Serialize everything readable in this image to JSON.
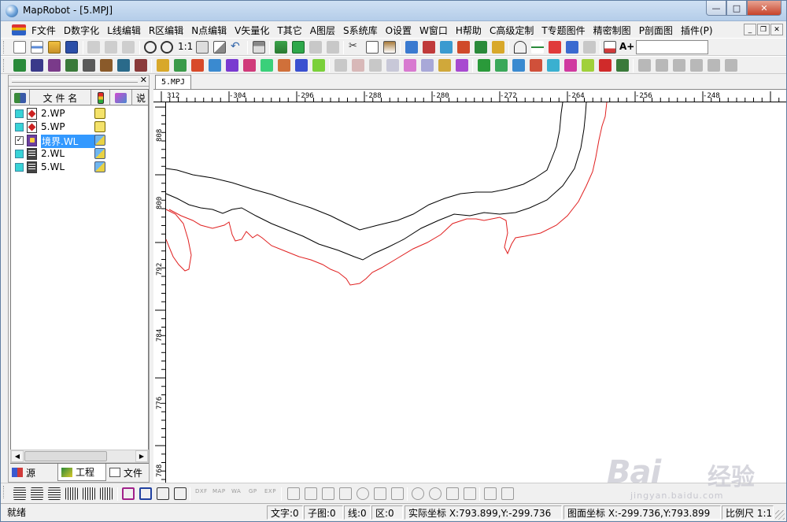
{
  "window": {
    "title": "MapRobot - [5.MPJ]",
    "caption": {
      "minimize": "—",
      "maximize": "□",
      "close": "✕"
    }
  },
  "menu": {
    "items": [
      "F文件",
      "D数字化",
      "L线编辑",
      "R区编辑",
      "N点编辑",
      "V矢量化",
      "T其它",
      "A图层",
      "S系统库",
      "O设置",
      "W窗口",
      "H帮助",
      "C高级定制",
      "T专题图件",
      "精密制图",
      "P剖面图",
      "插件(P)"
    ],
    "mdi": {
      "minimize": "_",
      "restore": "❐",
      "close": "✕"
    }
  },
  "toolbar": {
    "zoom_ratio_label": "1:1",
    "font_size_label": "A+",
    "font_input_value": ""
  },
  "colors": {
    "accent": "#3399ff",
    "boundary_line": "#e02020",
    "contour_line": "#000000",
    "layer_check": "#38d3d6"
  },
  "left_panel": {
    "close": "✕",
    "columns": {
      "filename": "文 件 名",
      "status": "",
      "desc": "说"
    },
    "layers": [
      {
        "name": "2.WP",
        "checked": false,
        "icon": "wp-file-icon",
        "state_icon": "lock-icon"
      },
      {
        "name": "5.WP",
        "checked": false,
        "icon": "wp-file-icon",
        "state_icon": "lock-icon"
      },
      {
        "name": "境界.WL",
        "checked": true,
        "selected": true,
        "icon": "wl-boundary-file-icon",
        "state_icon": "edit-icon"
      },
      {
        "name": "2.WL",
        "checked": false,
        "icon": "wl-file-icon",
        "state_icon": "edit-icon"
      },
      {
        "name": "5.WL",
        "checked": false,
        "icon": "wl-file-icon",
        "state_icon": "edit-icon"
      }
    ],
    "tabs": [
      {
        "label": "源",
        "icon": "source-icon"
      },
      {
        "label": "工程",
        "icon": "project-icon"
      },
      {
        "label": "文件",
        "icon": "file-icon"
      }
    ]
  },
  "document": {
    "tab_label": "5.MPJ",
    "ruler_top": [
      "312",
      "-304",
      "-296",
      "-288",
      "-280",
      "-272",
      "-264",
      "-256",
      "-248"
    ],
    "ruler_left": [
      "808",
      "800",
      "792",
      "784",
      "776",
      "768"
    ]
  },
  "bottom_toolbar": {
    "labels": [
      "DXF",
      "MAP",
      "WA",
      "GP",
      "EXP"
    ]
  },
  "status": {
    "ready": "就绪",
    "text_count": "文字:0",
    "subgraph_count": "子图:0",
    "line_count": "线:0",
    "area_count": "区:0",
    "real_coords": "实际坐标 X:793.899,Y:-299.736",
    "map_coords": "图面坐标 X:-299.736,Y:793.899",
    "scale": "比例尺 1:1"
  },
  "watermark": {
    "logo": "Bai",
    "logo_cn": "经验",
    "url": "jingyan.baidu.com"
  }
}
